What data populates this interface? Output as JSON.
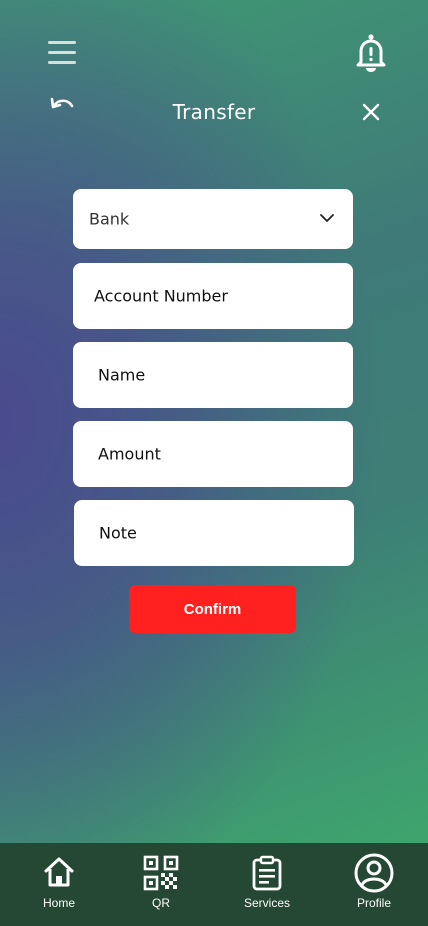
{
  "header": {
    "title": "Transfer"
  },
  "form": {
    "bank_select": {
      "value": "Bank"
    },
    "fields": {
      "account_number": "Account Number",
      "name": "Name",
      "amount": "Amount",
      "note": "Note"
    },
    "confirm_label": "Confirm"
  },
  "tabbar": {
    "items": [
      {
        "label": "Home",
        "icon": "home-icon"
      },
      {
        "label": "QR",
        "icon": "qr-code-icon"
      },
      {
        "label": "Services",
        "icon": "clipboard-icon"
      },
      {
        "label": "Profile",
        "icon": "profile-icon"
      }
    ]
  },
  "colors": {
    "confirm": "#ff2020",
    "tabbar": "#244833",
    "field_bg": "#ffffff"
  }
}
